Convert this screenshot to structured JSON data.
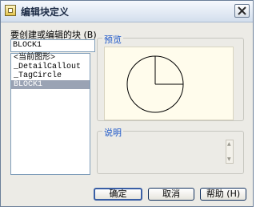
{
  "window": {
    "title": "编辑块定义"
  },
  "block_name_label": "要创建或编辑的块 (B)",
  "block_name_value": "BLOCK1",
  "block_list": [
    "<当前图形>",
    "_DetailCallout",
    "_TagCircle",
    "BLOCK1"
  ],
  "selected_block": "BLOCK1",
  "preview": {
    "label": "预览"
  },
  "description": {
    "label": "说明",
    "text": ""
  },
  "buttons": {
    "ok": "确定",
    "cancel": "取消",
    "help": "帮助 (H)"
  },
  "colors": {
    "group_label": "#1d57c8",
    "preview_bg": "#fffcec",
    "selection": "#9aa3b4"
  },
  "icons": {
    "title": "block-icon",
    "close": "close-icon"
  }
}
